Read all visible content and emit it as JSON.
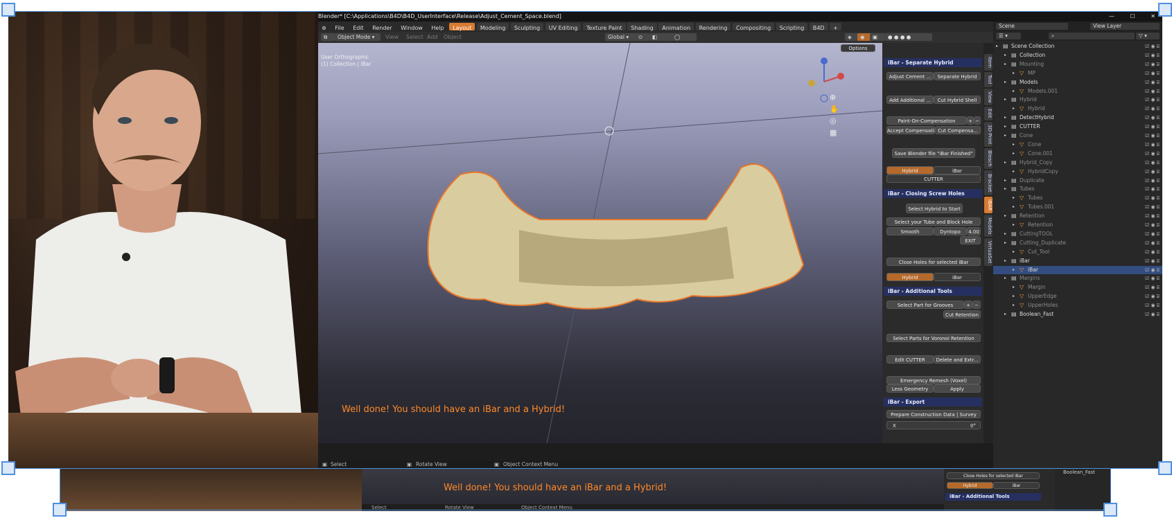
{
  "window": {
    "title": "Blender* [C:\\Applications\\B4D\\B4D_UserInterface\\Release\\Adjust_Cement_Space.blend]",
    "min": "—",
    "max": "☐",
    "close": "✕"
  },
  "menu": {
    "items": [
      "File",
      "Edit",
      "Render",
      "Window",
      "Help"
    ],
    "workspaces": [
      "Layout",
      "Modeling",
      "Sculpting",
      "UV Editing",
      "Texture Paint",
      "Shading",
      "Animation",
      "Rendering",
      "Compositing",
      "Scripting",
      "B4D"
    ],
    "add_workspace": "+",
    "scene": "Scene",
    "view_layer": "View Layer"
  },
  "header": {
    "mode": "Object Mode",
    "view": "View",
    "select": "Select",
    "add": "Add",
    "object": "Object",
    "transform": "Global",
    "options": "Options"
  },
  "viewport": {
    "info_line1": "User Orthographic",
    "info_line2": "(1) Collection | iBar",
    "message": "Well done! You should have an iBar and a Hybrid!"
  },
  "status": {
    "select": "Select",
    "rotate": "Rotate View",
    "context": "Object Context Menu"
  },
  "npanel": {
    "tabs": [
      "Item",
      "Tool",
      "View",
      "Edit",
      "3D-Print",
      "Bleach",
      "Bracket",
      "iBAR",
      "Models",
      "VirtuaSet"
    ],
    "separate": {
      "title": "iBar - Separate Hybrid",
      "adjust_cement": "Adjust Cement ...",
      "separate_hybrid": "Separate Hybrid",
      "add_additional": "Add Additional ...",
      "cut_hybrid_shell": "Cut Hybrid Shell",
      "paint_on": "Paint-On-Compensation",
      "accept": "Accept Compensation",
      "cut_comp": "Cut Compensa...",
      "save": "Save Blender file \"iBar Finished\"",
      "hybrid": "Hybrid",
      "ibar": "iBar",
      "cutter": "CUTTER"
    },
    "screw": {
      "title": "iBar - Closing Screw Holes",
      "select_hybrid": "Select Hybrid to Start",
      "select_tube": "Select your Tube and Block Hole",
      "smooth": "Smooth",
      "dyntopo": "Dyntopo",
      "dyntopo_val": "4.00",
      "exit": "EXIT",
      "close_holes": "Close Holes for selected iBar",
      "hybrid": "Hybrid",
      "ibar": "iBar"
    },
    "additional": {
      "title": "iBar - Additional Tools",
      "select_grooves": "Select Part for Grooves",
      "plus": "+",
      "minus": "−",
      "cut_retention": "Cut Retention",
      "voronoi": "Select Parts for Voronoi Retention",
      "edit_cutter": "Edit CUTTER",
      "delete_extr": "Delete and Extr...",
      "remesh": "Emergency Remesh (Voxel)",
      "less_geo": "Less Geometry",
      "apply": "Apply"
    },
    "export": {
      "title": "iBar - Export",
      "prepare": "Prepare Construction Data | Survey",
      "x": "X",
      "xval": "0°"
    }
  },
  "outliner": {
    "search_placeholder": "",
    "rows": [
      {
        "label": "Scene Collection",
        "indent": 0,
        "muted": false,
        "sel": false
      },
      {
        "label": "Collection",
        "indent": 1,
        "muted": false,
        "sel": false
      },
      {
        "label": "Mounting",
        "indent": 1,
        "muted": true,
        "sel": false
      },
      {
        "label": "MP",
        "indent": 2,
        "muted": true,
        "sel": false
      },
      {
        "label": "Models",
        "indent": 1,
        "muted": false,
        "sel": false
      },
      {
        "label": "Models.001",
        "indent": 2,
        "muted": true,
        "sel": false
      },
      {
        "label": "Hybrid",
        "indent": 1,
        "muted": true,
        "sel": false
      },
      {
        "label": "Hybrid",
        "indent": 2,
        "muted": true,
        "sel": false
      },
      {
        "label": "DetectHybrid",
        "indent": 1,
        "muted": false,
        "sel": false
      },
      {
        "label": "CUTTER",
        "indent": 1,
        "muted": false,
        "sel": false
      },
      {
        "label": "Cone",
        "indent": 1,
        "muted": true,
        "sel": false
      },
      {
        "label": "Cone",
        "indent": 2,
        "muted": true,
        "sel": false
      },
      {
        "label": "Cone.001",
        "indent": 2,
        "muted": true,
        "sel": false
      },
      {
        "label": "Hybrid_Copy",
        "indent": 1,
        "muted": true,
        "sel": false
      },
      {
        "label": "HybridCopy",
        "indent": 2,
        "muted": true,
        "sel": false
      },
      {
        "label": "Duplicate",
        "indent": 1,
        "muted": true,
        "sel": false
      },
      {
        "label": "Tubes",
        "indent": 1,
        "muted": true,
        "sel": false
      },
      {
        "label": "Tubes",
        "indent": 2,
        "muted": true,
        "sel": false
      },
      {
        "label": "Tubes.001",
        "indent": 2,
        "muted": true,
        "sel": false
      },
      {
        "label": "Retention",
        "indent": 1,
        "muted": true,
        "sel": false
      },
      {
        "label": "Retention",
        "indent": 2,
        "muted": true,
        "sel": false
      },
      {
        "label": "CuttingTOOL",
        "indent": 1,
        "muted": true,
        "sel": false
      },
      {
        "label": "Cutting_Duplicate",
        "indent": 1,
        "muted": true,
        "sel": false
      },
      {
        "label": "Cut_Tool",
        "indent": 2,
        "muted": true,
        "sel": false
      },
      {
        "label": "iBar",
        "indent": 1,
        "muted": false,
        "sel": false
      },
      {
        "label": "iBar",
        "indent": 2,
        "muted": false,
        "sel": true
      },
      {
        "label": "Margins",
        "indent": 1,
        "muted": true,
        "sel": false
      },
      {
        "label": "Margin",
        "indent": 2,
        "muted": true,
        "sel": false
      },
      {
        "label": "UpperEdge",
        "indent": 2,
        "muted": true,
        "sel": false
      },
      {
        "label": "UpperHoles",
        "indent": 2,
        "muted": true,
        "sel": false
      },
      {
        "label": "Boolean_Fast",
        "indent": 1,
        "muted": false,
        "sel": false
      }
    ]
  },
  "duplicate_strip": {
    "message": "Well done! You should have an iBar and a Hybrid!",
    "close_holes": "Close Holes for selected iBar",
    "hybrid": "Hybrid",
    "ibar": "iBar",
    "additional": "iBar - Additional Tools",
    "boolean": "Boolean_Fast",
    "select": "Select",
    "rotate": "Rotate View",
    "context": "Object Context Menu"
  },
  "colors": {
    "accent": "#d87b32",
    "panel_header": "#263060",
    "selection": "#334d80",
    "message": "#ff8a2a",
    "frame": "#4d8fe0"
  }
}
